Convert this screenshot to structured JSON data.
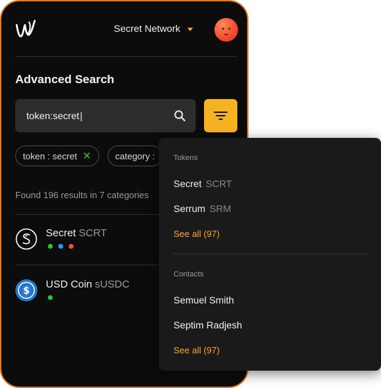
{
  "header": {
    "network": "Secret Network"
  },
  "page": {
    "title": "Advanced Search"
  },
  "search": {
    "value": "token:secret"
  },
  "chips": [
    {
      "label": "token : secret"
    },
    {
      "label": "category :"
    }
  ],
  "results": {
    "summary": "Found 196 results in 7 categories",
    "items": [
      {
        "name": "Secret",
        "symbol": "SCRT",
        "status_colors": [
          "#2fbf3a",
          "#2e9cf2",
          "#f0552e"
        ]
      },
      {
        "name": "USD Coin",
        "symbol": "sUSDC",
        "status_colors": [
          "#2fbf3a"
        ]
      }
    ]
  },
  "dropdown": {
    "tokens_header": "Tokens",
    "tokens": [
      {
        "name": "Secret",
        "symbol": "SCRT"
      },
      {
        "name": "Serrum",
        "symbol": "SRM"
      }
    ],
    "tokens_see_all": "See all (97)",
    "contacts_header": "Contacts",
    "contacts": [
      {
        "name": "Semuel Smith"
      },
      {
        "name": "Septim Radjesh"
      }
    ],
    "contacts_see_all": "See all (97)"
  },
  "colors": {
    "accent": "#f5a623",
    "panel_border": "#e07a1a",
    "background": "#0c0c0c"
  }
}
